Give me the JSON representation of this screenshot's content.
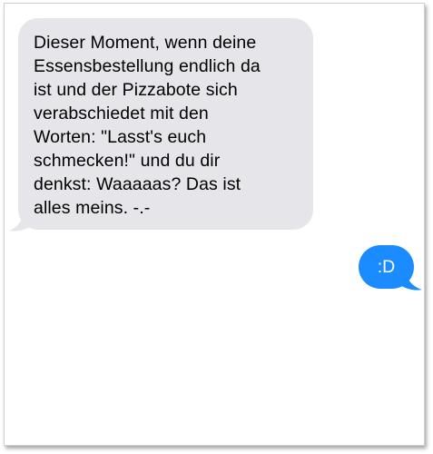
{
  "conversation": {
    "messages": [
      {
        "direction": "incoming",
        "text": "Dieser Moment, wenn deine\nEssensbestellung endlich da\nist und der Pizzabote sich\nverabschiedet mit den\nWorten: \"Lasst's euch\nschmecken!\" und du dir\ndenkst: Waaaaas? Das ist\nalles meins. -.-"
      },
      {
        "direction": "outgoing",
        "text": ":D"
      }
    ]
  },
  "colors": {
    "incoming_bubble": "#e5e5ea",
    "outgoing_bubble": "#1a8cff",
    "incoming_text": "#000000",
    "outgoing_text": "#ffffff"
  }
}
